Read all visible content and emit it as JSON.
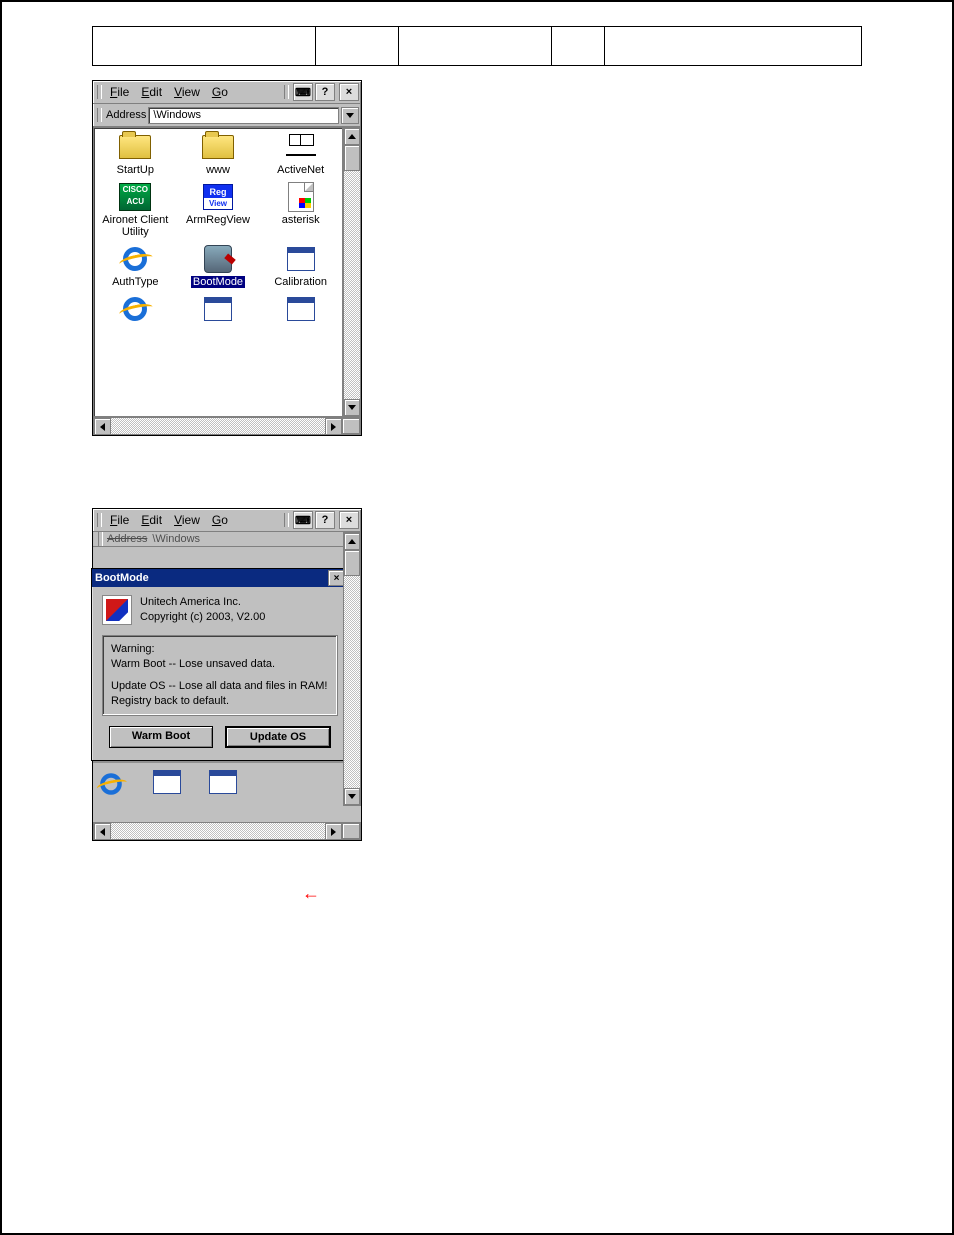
{
  "header": {
    "cells": [
      "",
      "",
      "",
      "",
      ""
    ]
  },
  "screenshot1": {
    "menu": {
      "file": "File",
      "edit": "Edit",
      "view": "View",
      "go": "Go",
      "help": "?"
    },
    "toolbar": {
      "close": "×",
      "keyboard_glyph": "⌨"
    },
    "address": {
      "label": "Address",
      "path": "\\Windows"
    },
    "icons": [
      {
        "label": "StartUp",
        "icon": "folder"
      },
      {
        "label": "www",
        "icon": "folder"
      },
      {
        "label": "ActiveNet",
        "icon": "net"
      },
      {
        "label": "Aironet Client Utility",
        "icon": "cisco"
      },
      {
        "label": "ArmRegView",
        "icon": "reg"
      },
      {
        "label": "asterisk",
        "icon": "file"
      },
      {
        "label": "AuthType",
        "icon": "ie"
      },
      {
        "label": "BootMode",
        "icon": "robot",
        "selected": true
      },
      {
        "label": "Calibration",
        "icon": "win"
      },
      {
        "label": "",
        "icon": "ie"
      },
      {
        "label": "",
        "icon": "win"
      },
      {
        "label": "",
        "icon": "win"
      }
    ]
  },
  "screenshot2": {
    "menu": {
      "file": "File",
      "edit": "Edit",
      "view": "View",
      "go": "Go",
      "help": "?"
    },
    "toolbar": {
      "close": "×",
      "keyboard_glyph": "⌨"
    },
    "address": {
      "label": "Address",
      "path": "\\Windows"
    },
    "dialog": {
      "title": "BootMode",
      "close": "×",
      "vendor": "Unitech America Inc.",
      "copyright": "Copyright (c) 2003, V2.00",
      "warning_heading": "Warning:",
      "warn_line1": "Warm Boot -- Lose unsaved data.",
      "warn_line2": "Update OS -- Lose all data and files in RAM! Registry back to default.",
      "buttons": {
        "warm": "Warm Boot",
        "update": "Update OS"
      }
    }
  },
  "red_arrow": "←"
}
